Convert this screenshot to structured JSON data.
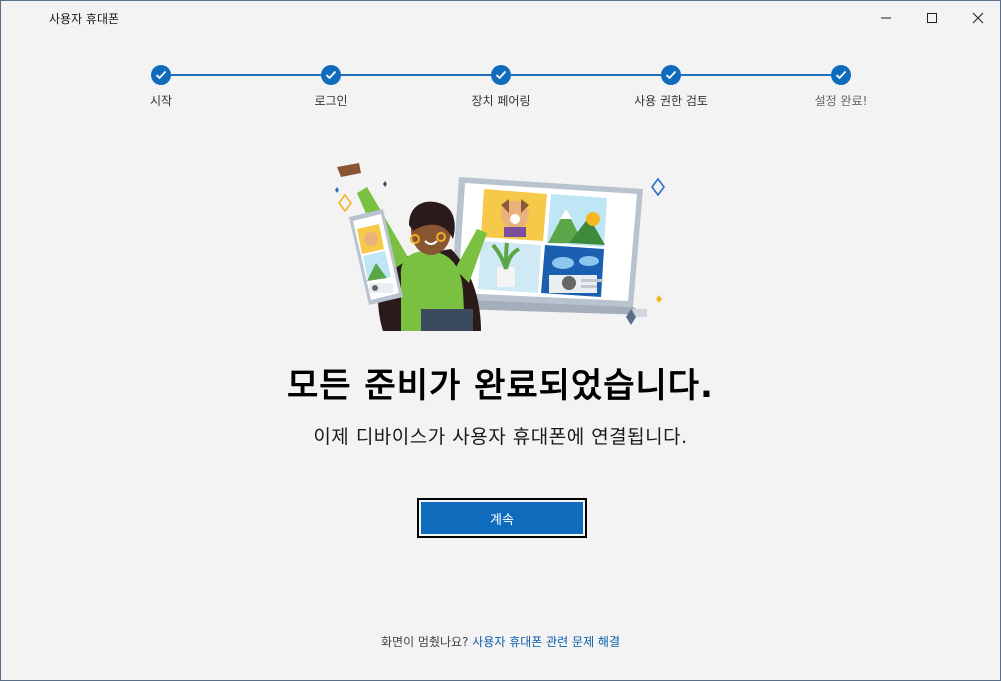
{
  "window": {
    "title": "사용자 휴대폰"
  },
  "controls": {
    "minimize_icon": "minimize-icon",
    "maximize_icon": "maximize-icon",
    "close_icon": "close-icon"
  },
  "stepper": {
    "steps": [
      {
        "label": "시작",
        "status": "complete"
      },
      {
        "label": "로그인",
        "status": "complete"
      },
      {
        "label": "장치 페어링",
        "status": "complete"
      },
      {
        "label": "사용 권한 검토",
        "status": "complete"
      },
      {
        "label": "설정 완료!",
        "status": "complete"
      }
    ],
    "accent_color": "#0f6cbd"
  },
  "main": {
    "headline": "모든 준비가 완료되었습니다.",
    "subline": "이제 디바이스가 사용자 휴대폰에 연결됩니다.",
    "continue_label": "계속"
  },
  "footer": {
    "question": "화면이 멈췄나요? ",
    "link": "사용자 휴대폰 관련 문제 해결"
  }
}
